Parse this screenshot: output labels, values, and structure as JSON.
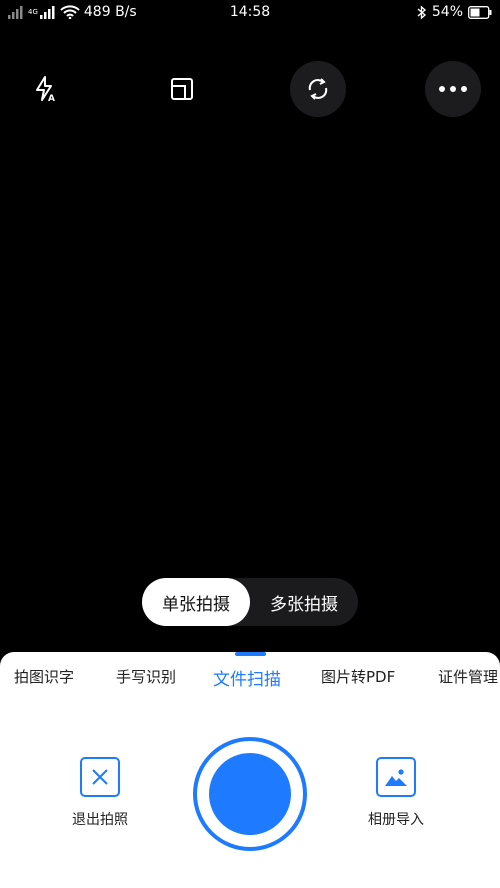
{
  "status_bar": {
    "network_label": "4G",
    "speed": "489 B/s",
    "time": "14:58",
    "battery": "54%"
  },
  "toolbar": {
    "flash_icon": "flash-auto-icon",
    "crop_icon": "crop-frame-icon",
    "rotate_icon": "rotate-camera-icon",
    "more_icon": "more-icon"
  },
  "capture_mode": {
    "options": [
      "单张拍摄",
      "多张拍摄"
    ],
    "selected": "单张拍摄"
  },
  "tabs": {
    "items": [
      "拍图识字",
      "手写识别",
      "文件扫描",
      "图片转PDF",
      "证件管理"
    ],
    "active": "文件扫描"
  },
  "actions": {
    "exit_label": "退出拍照",
    "album_label": "相册导入"
  },
  "colors": {
    "accent": "#1e7bff",
    "background": "#000000",
    "panel": "#ffffff"
  }
}
